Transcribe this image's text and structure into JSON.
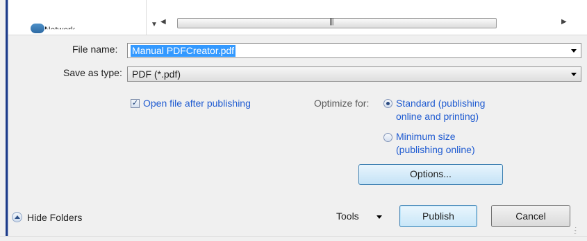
{
  "nav": {
    "network_label": "Network"
  },
  "form": {
    "file_name_label": "File name:",
    "file_name_value": "Manual PDFCreator.pdf",
    "save_type_label": "Save as type:",
    "save_type_value": "PDF (*.pdf)"
  },
  "options": {
    "open_after_label": "Open file after publishing",
    "open_after_checked": true,
    "optimize_label": "Optimize for:",
    "standard_line1": "Standard (publishing",
    "standard_line2": "online and printing)",
    "minimum_line1": "Minimum size",
    "minimum_line2": "(publishing online)",
    "selected_option": "Standard",
    "options_button": "Options..."
  },
  "footer": {
    "hide_folders": "Hide Folders",
    "tools": "Tools",
    "publish": "Publish",
    "cancel": "Cancel"
  },
  "colors": {
    "accent": "#1f5bd1",
    "selection": "#3399ff"
  }
}
